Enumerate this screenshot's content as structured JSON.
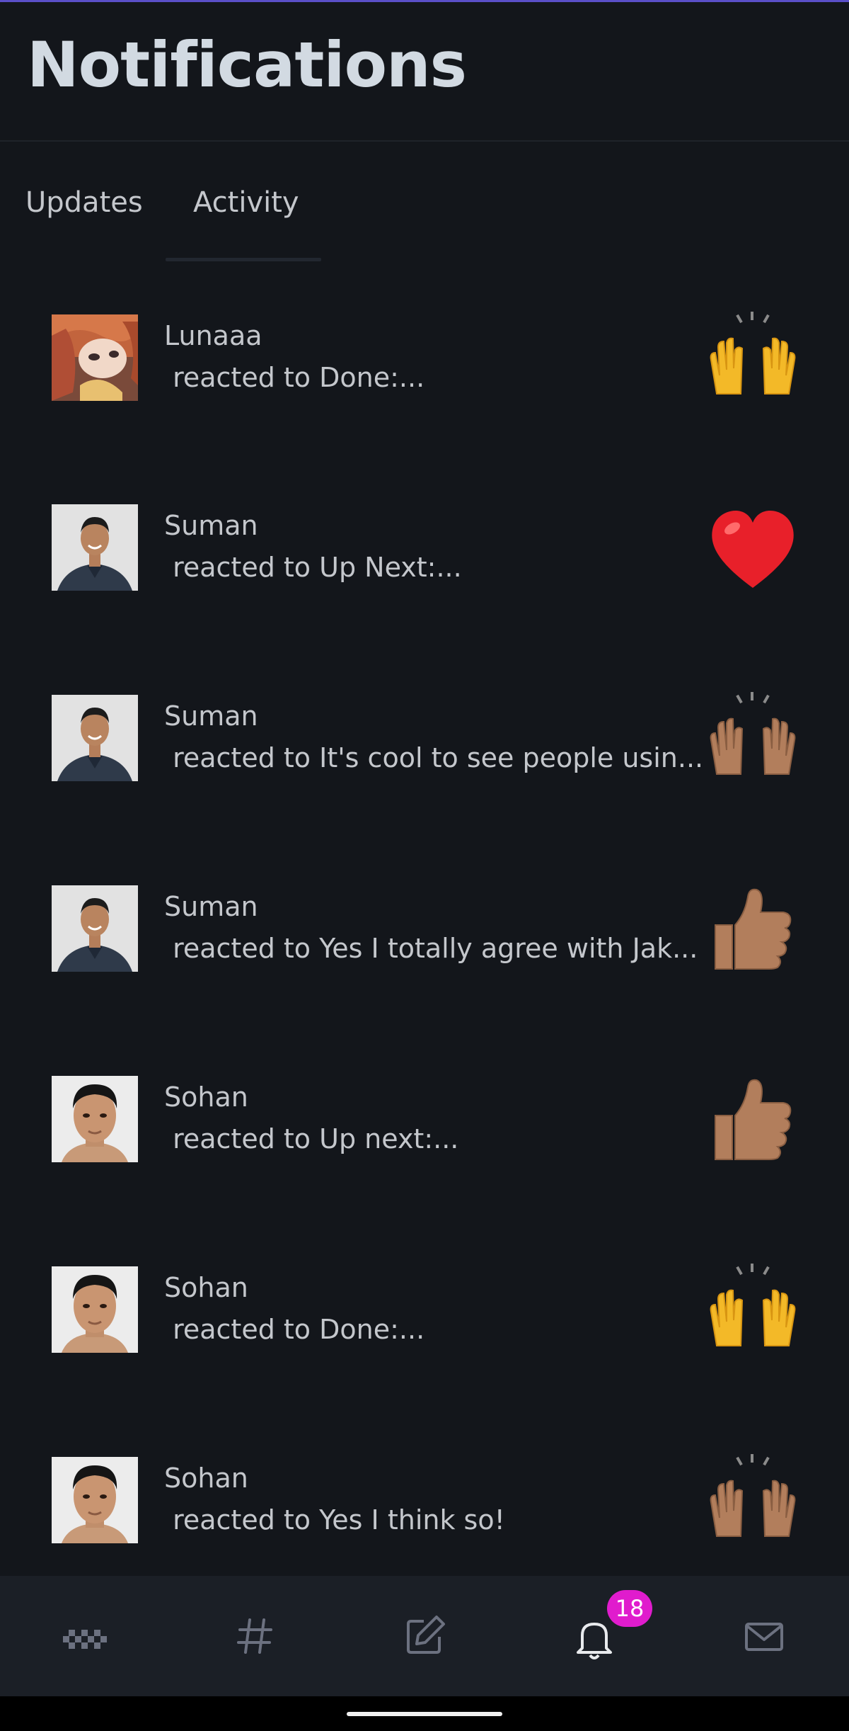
{
  "header": {
    "title": "Notifications"
  },
  "tabs": [
    {
      "label": "Updates",
      "selected": false
    },
    {
      "label": "Activity",
      "selected": true
    }
  ],
  "notifications": [
    {
      "name": "Lunaaa",
      "text": " reacted to Done:...",
      "reaction": "raising-hands",
      "skin_tone": "default",
      "avatar": "anime-girl-red-hair"
    },
    {
      "name": "Suman",
      "text": " reacted to Up Next:...",
      "reaction": "red-heart",
      "skin_tone": "default",
      "avatar": "man-dark-shirt"
    },
    {
      "name": "Suman",
      "text": " reacted to It's cool to see people usin...",
      "reaction": "raising-hands",
      "skin_tone": "medium",
      "avatar": "man-dark-shirt"
    },
    {
      "name": "Suman",
      "text": " reacted to Yes I totally agree with Jak...",
      "reaction": "thumbs-up",
      "skin_tone": "medium",
      "avatar": "man-dark-shirt"
    },
    {
      "name": "Sohan",
      "text": " reacted to Up next:...",
      "reaction": "thumbs-up",
      "skin_tone": "medium",
      "avatar": "man-portrait"
    },
    {
      "name": "Sohan",
      "text": " reacted to Done:...",
      "reaction": "raising-hands",
      "skin_tone": "default",
      "avatar": "man-portrait"
    },
    {
      "name": "Sohan",
      "text": " reacted to Yes I think so!",
      "reaction": "raising-hands",
      "skin_tone": "medium",
      "avatar": "man-portrait"
    }
  ],
  "bottom_nav": {
    "items": [
      "home-icon",
      "hashtag-icon",
      "compose-icon",
      "bell-icon",
      "mail-icon"
    ],
    "active": "bell-icon",
    "notification_badge": "18"
  },
  "colors": {
    "background": "#13161b",
    "nav_background": "#1b1f26",
    "badge": "#e01ccd",
    "title": "#d2dae2",
    "text": "#c4c7cc"
  }
}
